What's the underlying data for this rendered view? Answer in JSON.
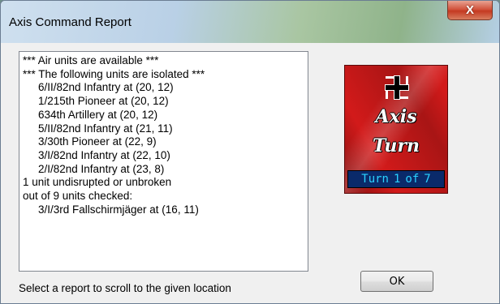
{
  "window": {
    "title": "Axis Command Report",
    "close_label": "X"
  },
  "report_lines": [
    {
      "text": "*** Air units are available ***",
      "indent": false
    },
    {
      "text": "*** The following units are isolated ***",
      "indent": false
    },
    {
      "text": "6/II/82nd Infantry at (20, 12)",
      "indent": true
    },
    {
      "text": "1/215th Pioneer at (20, 12)",
      "indent": true
    },
    {
      "text": "634th Artillery at (20, 12)",
      "indent": true
    },
    {
      "text": "5/II/82nd Infantry at (21, 11)",
      "indent": true
    },
    {
      "text": "3/30th Pioneer at (22, 9)",
      "indent": true
    },
    {
      "text": "3/I/82nd Infantry at (22, 10)",
      "indent": true
    },
    {
      "text": "2/I/82nd Infantry at (23, 8)",
      "indent": true
    },
    {
      "text": "1 unit undisrupted or unbroken",
      "indent": false
    },
    {
      "text": "out of 9 units checked:",
      "indent": false
    },
    {
      "text": "3/I/3rd Fallschirmjäger at (16, 11)",
      "indent": true
    }
  ],
  "status_text": "Select a report to scroll to the given location",
  "turn_card": {
    "side_word": "Axis",
    "turn_word": "Turn",
    "turn_label": "Turn",
    "current_turn": "1",
    "of_label": "of",
    "total_turns": "7",
    "icon": "iron-cross-icon"
  },
  "ok_label": "OK"
}
